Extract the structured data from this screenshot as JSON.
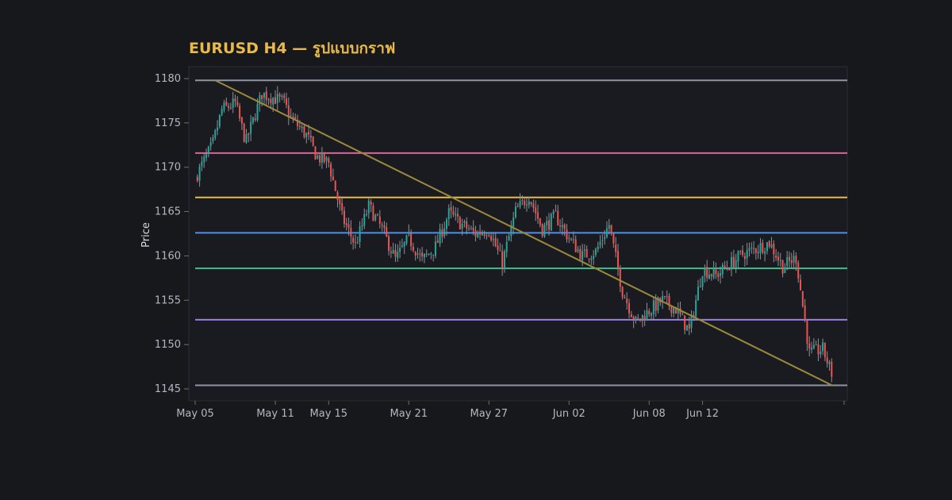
{
  "chart_data": {
    "type": "candlestick",
    "title": "EURUSD H4 — รูปแบบกราฟ",
    "ylabel": "Price",
    "xlabel": "",
    "ylim": [
      1144,
      1181
    ],
    "y_ticks": [
      1145,
      1150,
      1155,
      1160,
      1165,
      1170,
      1175,
      1180
    ],
    "x_ticks": [
      {
        "label": "May 05",
        "day": 0
      },
      {
        "label": "May 11",
        "day": 6
      },
      {
        "label": "May 15",
        "day": 10
      },
      {
        "label": "May 21",
        "day": 16
      },
      {
        "label": "May 27",
        "day": 22
      },
      {
        "label": "Jun 02",
        "day": 28
      },
      {
        "label": "Jun 08",
        "day": 34
      },
      {
        "label": "Jun 12",
        "day": 38
      }
    ],
    "x_range_days": [
      0,
      48.6
    ],
    "horizontal_levels": [
      {
        "value": 1179.8,
        "color": "#8e96a3"
      },
      {
        "value": 1171.6,
        "color": "#d9659a"
      },
      {
        "value": 1166.6,
        "color": "#e9b949"
      },
      {
        "value": 1162.6,
        "color": "#4f8fe8"
      },
      {
        "value": 1158.6,
        "color": "#3fbf8a"
      },
      {
        "value": 1152.8,
        "color": "#9a7fe0"
      },
      {
        "value": 1145.4,
        "color": "#8e96a3"
      }
    ],
    "trendline": {
      "from": [
        1.5,
        1179.8
      ],
      "to": [
        47.7,
        1145.4
      ],
      "color": "#9c8a3c"
    },
    "colors": {
      "up": "#26a69a",
      "down": "#ef5350",
      "wick": "#8b9099",
      "frame": "#2b2e36",
      "plot_bg": "#1a1b20"
    },
    "candles_anchor_close": [
      [
        0,
        1168.8
      ],
      [
        1.3,
        1172.5
      ],
      [
        2,
        1176.5
      ],
      [
        3,
        1177.2
      ],
      [
        3.8,
        1172.8
      ],
      [
        5,
        1178.3
      ],
      [
        6.6,
        1177.4
      ],
      [
        7.2,
        1175.5
      ],
      [
        8.4,
        1173.5
      ],
      [
        9.1,
        1171.2
      ],
      [
        10,
        1170.5
      ],
      [
        11,
        1164.4
      ],
      [
        12,
        1161.2
      ],
      [
        13,
        1165.6
      ],
      [
        14,
        1163.0
      ],
      [
        15,
        1159.6
      ],
      [
        16,
        1162.0
      ],
      [
        17,
        1159.5
      ],
      [
        18,
        1161.0
      ],
      [
        19,
        1164.8
      ],
      [
        20,
        1163.5
      ],
      [
        21,
        1162.5
      ],
      [
        22,
        1163.0
      ],
      [
        23,
        1159.2
      ],
      [
        24,
        1165.0
      ],
      [
        25,
        1166.8
      ],
      [
        26,
        1163.0
      ],
      [
        27,
        1164.5
      ],
      [
        28,
        1162.0
      ],
      [
        29,
        1160.0
      ],
      [
        30,
        1160.5
      ],
      [
        31,
        1163.5
      ],
      [
        32,
        1156.0
      ],
      [
        33,
        1152.5
      ],
      [
        34,
        1153.8
      ],
      [
        35,
        1155.0
      ],
      [
        36,
        1154.0
      ],
      [
        37,
        1151.5
      ],
      [
        38,
        1158.5
      ],
      [
        39,
        1157.8
      ],
      [
        40,
        1159.0
      ],
      [
        41,
        1160.2
      ],
      [
        42,
        1160.8
      ],
      [
        43,
        1161.5
      ],
      [
        44,
        1158.8
      ],
      [
        45,
        1159.8
      ],
      [
        46,
        1149.0
      ],
      [
        47,
        1149.5
      ],
      [
        47.7,
        1146.6
      ]
    ]
  }
}
